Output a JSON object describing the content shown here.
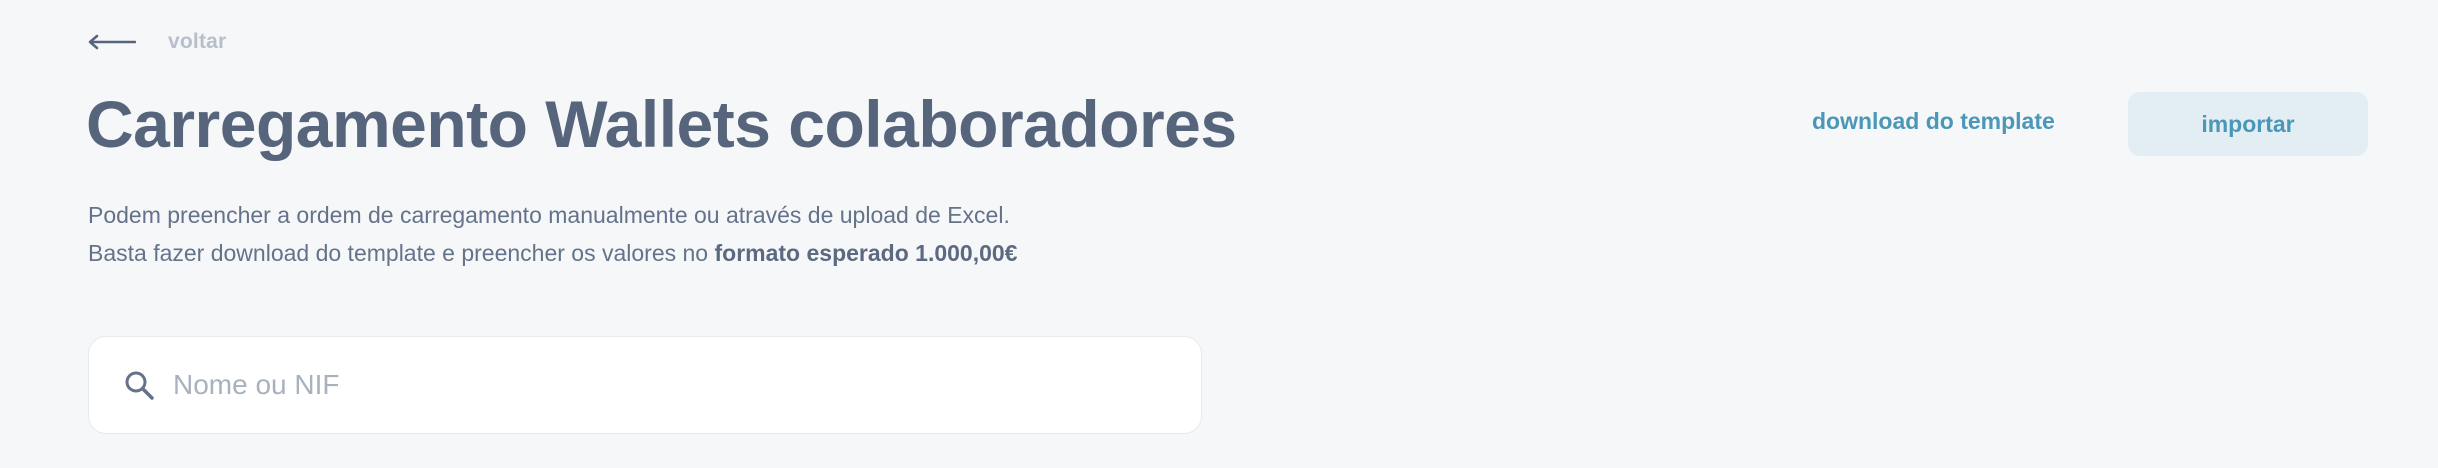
{
  "nav": {
    "back_label": "voltar",
    "back_icon": "arrow-left-icon"
  },
  "header": {
    "title": "Carregamento Wallets colaboradores",
    "download_label": "download do template",
    "import_label": "importar"
  },
  "description": {
    "line1": "Podem preencher a ordem de carregamento manualmente ou através de upload de Excel.",
    "line2_prefix": "Basta fazer download do template e preencher os valores no ",
    "line2_bold": "formato esperado 1.000,00€"
  },
  "search": {
    "placeholder": "Nome ou NIF",
    "value": "",
    "icon": "search-icon"
  },
  "colors": {
    "background": "#f6f7f9",
    "title": "#56657b",
    "accent": "#4a97b8",
    "button_bg": "#e2eef3",
    "muted": "#b6bfcb"
  }
}
